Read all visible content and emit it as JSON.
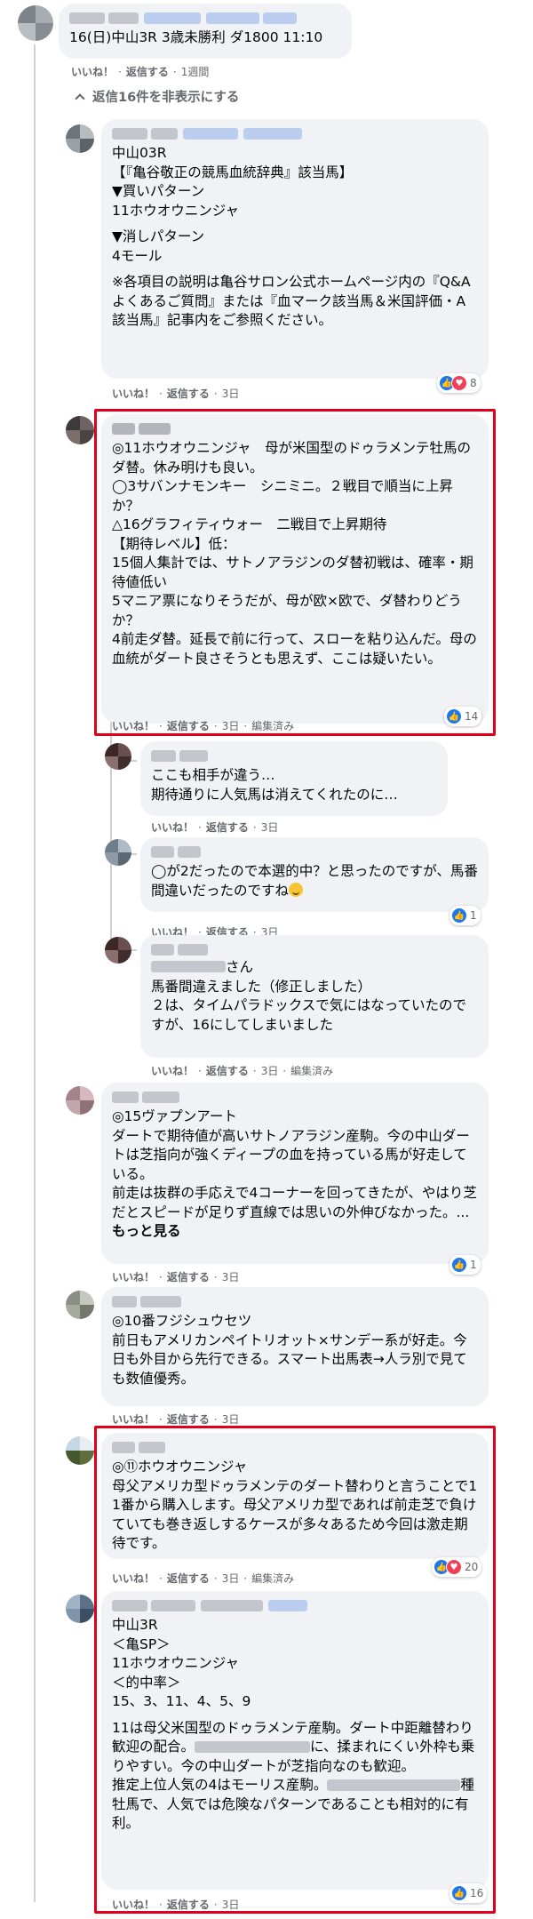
{
  "ui": {
    "like": "いいね！",
    "reply": "返信する",
    "dot": "·",
    "edited": "編集済み",
    "hide_replies": "返信16件を非表示にする",
    "see_more": "もっと見る",
    "like_icon": "thumbs-up-icon",
    "love_icon": "heart-icon",
    "hide_icon": "chevron-up-icon"
  },
  "colors": {
    "bubble": "#f0f2f5",
    "highlight_border": "#e0001b",
    "like_blue": "#1877f2",
    "love_red": "#f33e58",
    "meta_gray": "#65676b"
  },
  "comments": [
    {
      "text": "16(日)中山3R 3歳未勝利 ダ1800 11:10",
      "time": "1週間"
    },
    {
      "text": "中山03R\n【『亀谷敬正の競馬血統辞典』該当馬】\n▼買いパターン\n11ホウオウニンジャ",
      "text2": "▼消しパターン\n4モール",
      "text3": "※各項目の説明は亀谷サロン公式ホームページ内の『Q&A　よくあるご質問』または『血マーク該当馬＆米国評価・A該当馬』記事内をご参照ください。",
      "time": "3日",
      "reactions": "8"
    },
    {
      "text": "◎11ホウオウニンジャ　母が米国型のドゥラメンテ牡馬のダ替。休み明けも良い。\n◯3サバンナモンキー　シニミニ。２戦目で順当に上昇か？\n△16グラフィティウォー　二戦目で上昇期待\n【期待レベル】低：\n15個人集計では、サトノアラジンのダ替初戦は、確率・期待値低い\n5マニア票になりそうだが、母が欧×欧で、ダ替わりどうか？\n4前走ダ替。延長で前に行って、スローを粘り込んだ。母の血統がダート良さそうとも思えず、ここは疑いたい。",
      "time": "3日",
      "reactions": "14"
    },
    {
      "text": "ここも相手が違う…\n期待通りに人気馬は消えてくれたのに…",
      "time": "3日"
    },
    {
      "text": "◯が2だったので本選的中？と思ったのですが、馬番間違いだったのですね",
      "time": "3日",
      "reactions": "1"
    },
    {
      "text_suffix": "さん",
      "text": "馬番間違えました（修正しました）\n２は、タイムパラドックスで気にはなっていたのですが、16にしてしまいました",
      "time": "3日"
    },
    {
      "text": "◎15ヴァプンアート\nダートで期待値が高いサトノアラジン産駒。今の中山ダートは芝指向が強くディープの血を持っている馬が好走している。\n前走は抜群の手応えで4コーナーを回ってきたが、やはり芝だとスピードが足りず直線では思いの外伸びなかった。...",
      "time": "3日",
      "reactions": "1"
    },
    {
      "text": "◎10番フジシュウセツ\n前日もアメリカンペイトリオット×サンデー系が好走。今日も外目から先行できる。スマート出馬表→人ラ別で見ても数値優秀。",
      "time": "3日"
    },
    {
      "text": "◎⑪ホウオウニンジャ\n母父アメリカ型ドゥラメンテのダート替わりと言うことで11番から購入します。母父アメリカ型であれば前走芝で負けていても巻き返しするケースが多々あるため今回は激走期待です。",
      "time": "3日",
      "reactions": "20"
    },
    {
      "text": "中山3R\n＜亀SP＞\n11ホウオウニンジャ\n＜的中率＞\n15、3、11、4、5、9",
      "text2a": "11は母父米国型のドゥラメンテ産駒。ダート中距離替わり歓迎の配合。",
      "text2b": "に、揉まれにくい外枠も乗りやすい。今の中山ダートが芝指向なのも歓迎。\n推定上位人気の4はモーリス産駒。",
      "text2c": "種牡馬で、人気では危険なパターンであることも相対的に有利。",
      "time": "3日",
      "reactions": "16"
    }
  ]
}
